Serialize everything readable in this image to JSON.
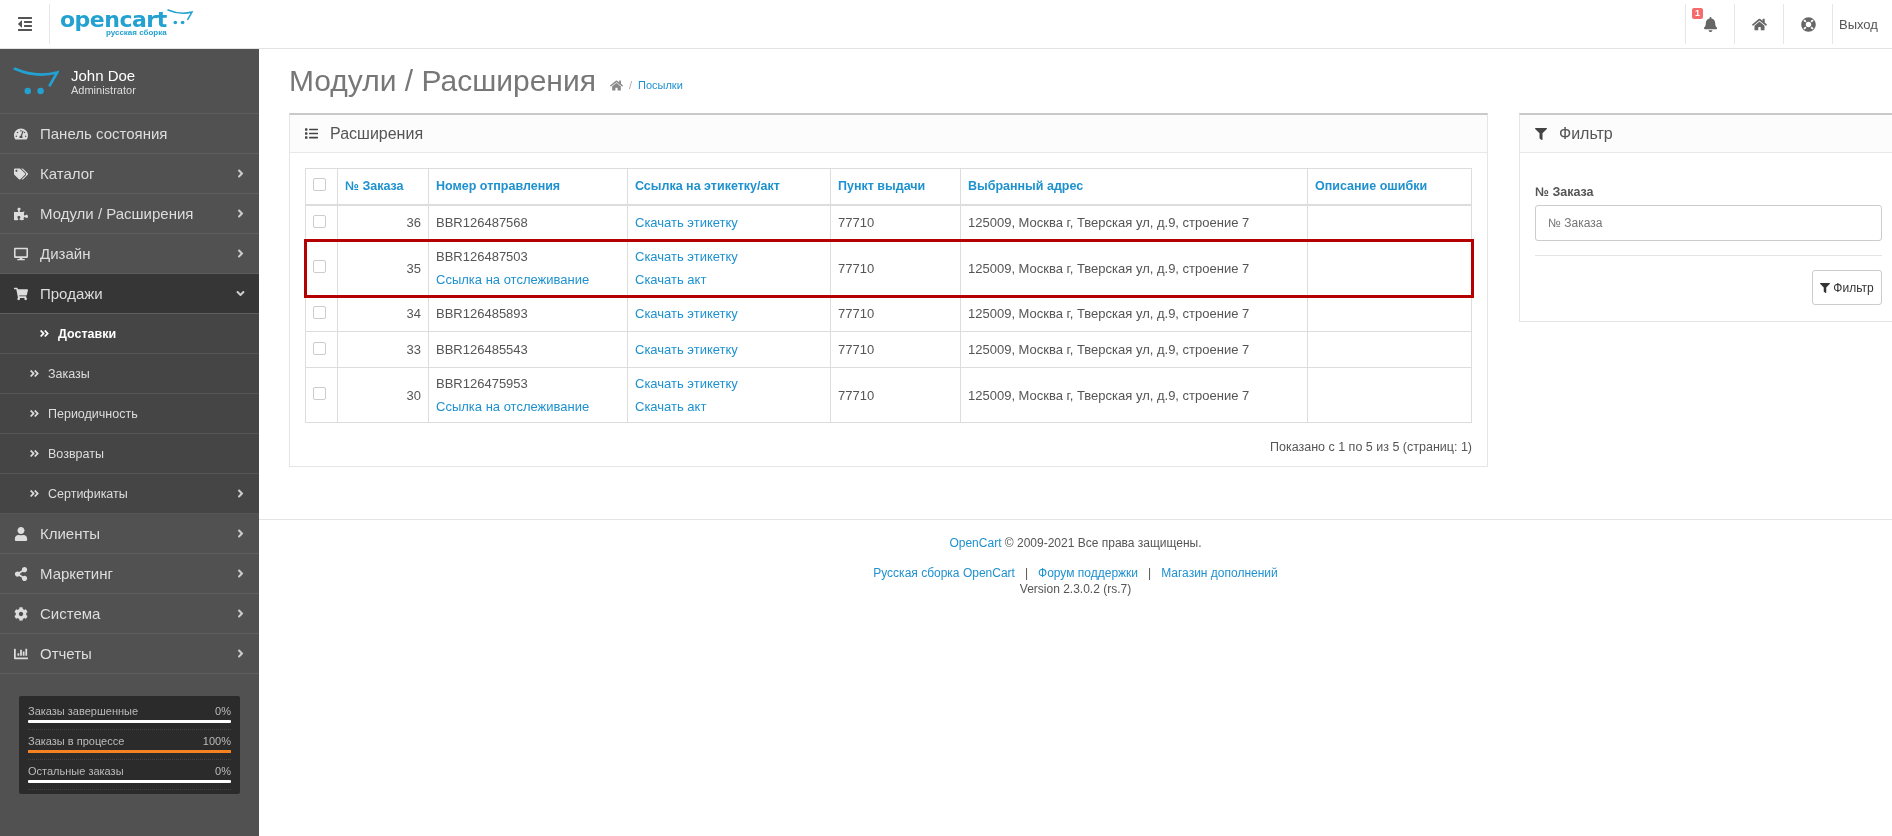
{
  "header": {
    "logo": {
      "name": "opencart",
      "tagline": "русская сборка"
    },
    "notifications": {
      "count": "1"
    },
    "logout": "Выход"
  },
  "user": {
    "name": "John Doe",
    "role": "Administrator"
  },
  "sidebar": {
    "items": [
      {
        "label": "Панель состояния",
        "kind": "link",
        "expanded": false
      },
      {
        "label": "Каталог",
        "kind": "menu",
        "expanded": false
      },
      {
        "label": "Модули / Расширения",
        "kind": "menu",
        "expanded": false
      },
      {
        "label": "Дизайн",
        "kind": "menu",
        "expanded": false
      },
      {
        "label": "Продажи",
        "kind": "menu",
        "expanded": true,
        "children": [
          {
            "label": "Доставки",
            "kind": "link",
            "selected": true
          },
          {
            "label": "Заказы",
            "kind": "link",
            "selected": false
          },
          {
            "label": "Периодичность",
            "kind": "link",
            "selected": false
          },
          {
            "label": "Возвраты",
            "kind": "link",
            "selected": false
          },
          {
            "label": "Сертификаты",
            "kind": "menu",
            "selected": false
          }
        ]
      },
      {
        "label": "Клиенты",
        "kind": "menu",
        "expanded": false
      },
      {
        "label": "Маркетинг",
        "kind": "menu",
        "expanded": false
      },
      {
        "label": "Система",
        "kind": "menu",
        "expanded": false
      },
      {
        "label": "Отчеты",
        "kind": "menu",
        "expanded": false
      }
    ],
    "stats": [
      {
        "label": "Заказы завершенные",
        "reading": "0%",
        "level": 0
      },
      {
        "label": "Заказы в процессе",
        "reading": "100%",
        "level": 1
      },
      {
        "label": "Остальные заказы",
        "reading": "0%",
        "level": 0
      }
    ]
  },
  "page": {
    "title": "Модули / Расширения",
    "breadcrumb": {
      "separator": "/",
      "current": "Посылки"
    }
  },
  "panel": {
    "title": "Расширения",
    "table": {
      "select_all": {
        "checked": false
      },
      "columns": [
        "№ Заказа",
        "Номер отправления",
        "Ссылка на этикетку/акт",
        "Пункт выдачи",
        "Выбранный адрес",
        "Описание ошибки"
      ],
      "rows": [
        {
          "checked": false,
          "highlighted": false,
          "order": "36",
          "shipment": "BBR126487568",
          "links": [
            "Скачать этикетку"
          ],
          "point": "77710",
          "address": "125009, Москва г, Тверская ул, д.9, строение 7"
        },
        {
          "checked": false,
          "highlighted": true,
          "order": "35",
          "shipment": "BBR126487503",
          "tracking": "Ссылка на отслеживание",
          "links": [
            "Скачать этикетку",
            "Скачать акт"
          ],
          "point": "77710",
          "address": "125009, Москва г, Тверская ул, д.9, строение 7"
        },
        {
          "checked": false,
          "highlighted": false,
          "order": "34",
          "shipment": "BBR126485893",
          "links": [
            "Скачать этикетку"
          ],
          "point": "77710",
          "address": "125009, Москва г, Тверская ул, д.9, строение 7"
        },
        {
          "checked": false,
          "highlighted": false,
          "order": "33",
          "shipment": "BBR126485543",
          "links": [
            "Скачать этикетку"
          ],
          "point": "77710",
          "address": "125009, Москва г, Тверская ул, д.9, строение 7"
        },
        {
          "checked": false,
          "highlighted": false,
          "order": "30",
          "shipment": "BBR126475953",
          "tracking": "Ссылка на отслеживание",
          "links": [
            "Скачать этикетку",
            "Скачать акт"
          ],
          "point": "77710",
          "address": "125009, Москва г, Тверская ул, д.9, строение 7"
        }
      ]
    },
    "pagination": "Показано с 1 по 5 из 5 (страниц: 1)"
  },
  "filter": {
    "title": "Фильтр",
    "field_label": "№ Заказа",
    "placeholder": "№ Заказа",
    "button": "Фильтр"
  },
  "footer": {
    "brand": "OpenCart",
    "copyright": " © 2009-2021 Все права защищены.",
    "separator": "|",
    "links": [
      "Русская сборка OpenCart",
      "Форум поддержки",
      "Магазин дополнений"
    ],
    "version": "Version 2.3.0.2 (rs.7)"
  }
}
